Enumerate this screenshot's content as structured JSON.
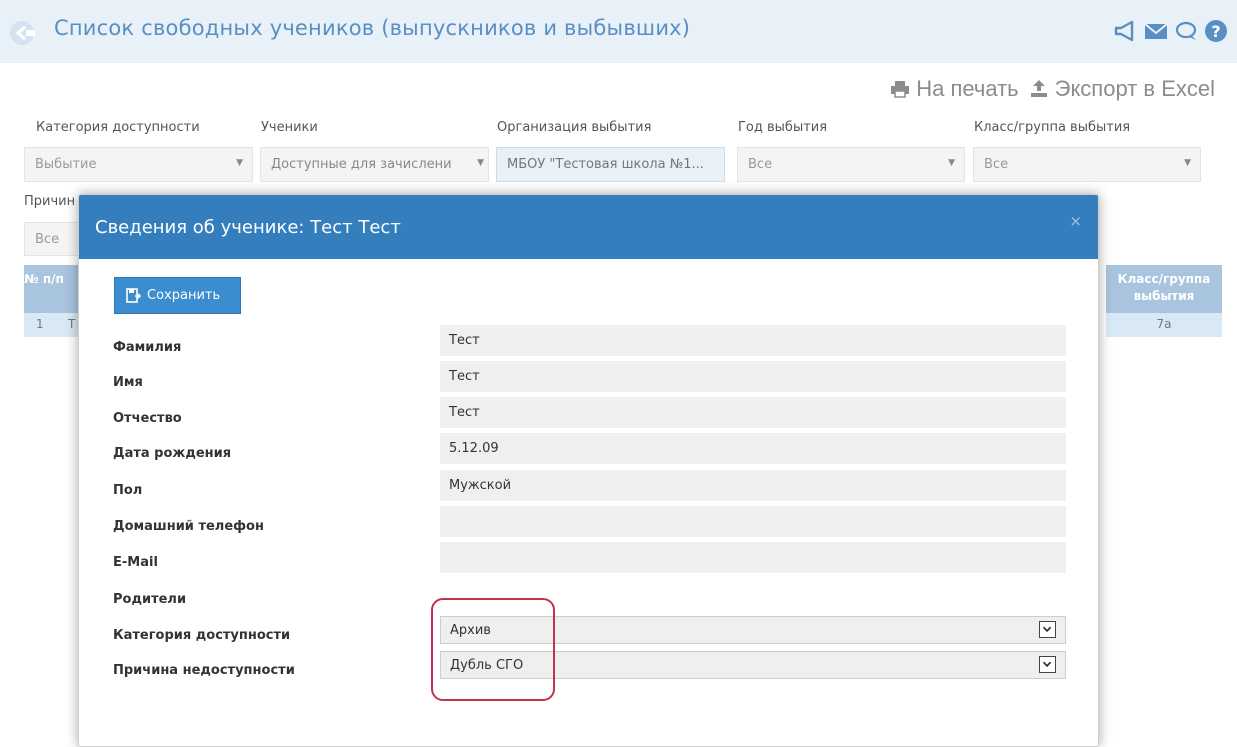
{
  "header": {
    "title": "Список свободных учеников (выпускников и выбывших)",
    "icons": [
      "back-icon",
      "megaphone-icon",
      "mail-icon",
      "chat-icon",
      "help-icon"
    ]
  },
  "actions": {
    "print_label": "На печать",
    "export_label": "Экспорт в Excel"
  },
  "filters": [
    {
      "label": "Категория доступности",
      "value": "Выбытие"
    },
    {
      "label": "Ученики",
      "value": "Доступные для зачислени"
    },
    {
      "label": "Организация выбытия",
      "value": "МБОУ \"Тестовая школа №1..."
    },
    {
      "label": "Год выбытия",
      "value": "Все"
    },
    {
      "label": "Класс/группа выбытия",
      "value": "Все"
    }
  ],
  "filter2": {
    "label": "Причин",
    "value": "Все"
  },
  "table": {
    "col_num": "№ п/п",
    "col_class": "Класс/группа выбытия",
    "row": {
      "num": "1",
      "name": "Т",
      "class": "7а"
    }
  },
  "modal": {
    "title": "Сведения об ученике: Тест Тест",
    "close": "×",
    "save_label": "Сохранить",
    "fields": [
      {
        "label": "Фамилия",
        "value": "Тест"
      },
      {
        "label": "Имя",
        "value": "Тест"
      },
      {
        "label": "Отчество",
        "value": "Тест"
      },
      {
        "label": "Дата рождения",
        "value": "5.12.09"
      },
      {
        "label": "Пол",
        "value": "Мужской"
      },
      {
        "label": "Домашний телефон",
        "value": ""
      },
      {
        "label": "E-Mail",
        "value": ""
      }
    ],
    "parents_label": "Родители",
    "access_category": {
      "label": "Категория доступности",
      "value": "Архив"
    },
    "unavailable_reason": {
      "label": "Причина недоступности",
      "value": "Дубль СГО"
    }
  },
  "colors": {
    "header_bg": "#e8f0f8",
    "title": "#5a8fc4",
    "modal_header": "#357ebd",
    "highlight": "#c0334d"
  }
}
